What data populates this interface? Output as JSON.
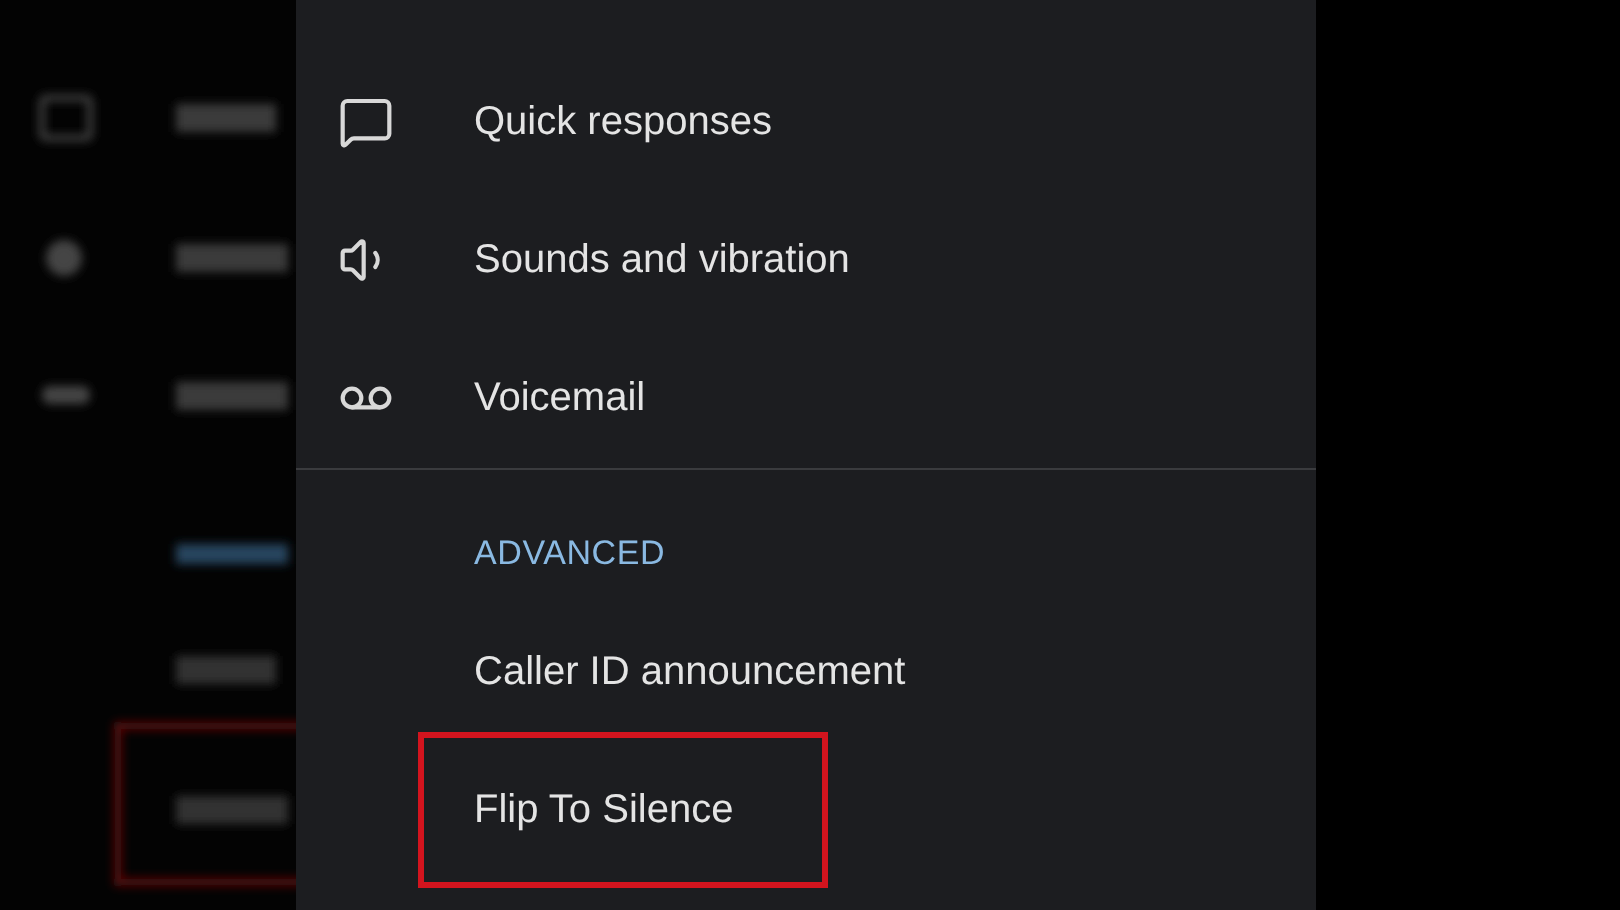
{
  "items": [
    {
      "kind": "item",
      "label": "Quick responses",
      "highlighted": false
    },
    {
      "kind": "item",
      "label": "Sounds and vibration",
      "highlighted": false
    },
    {
      "kind": "item",
      "label": "Voicemail",
      "highlighted": false
    },
    {
      "kind": "divider"
    },
    {
      "kind": "header",
      "label": "ADVANCED"
    },
    {
      "kind": "item",
      "label": "Caller ID announcement",
      "highlighted": false
    },
    {
      "kind": "item",
      "label": "Flip To Silence",
      "highlighted": true
    }
  ]
}
